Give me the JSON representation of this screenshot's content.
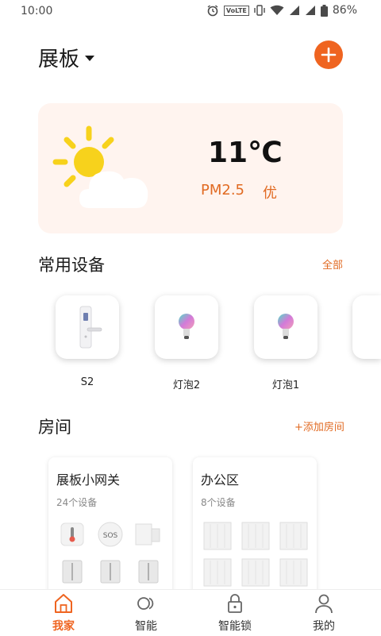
{
  "status_bar": {
    "time": "10:00",
    "network_badge": "VoLTE",
    "battery": "86%"
  },
  "header": {
    "home_name": "展板",
    "dropdown_icon": "caret-down-icon",
    "add_icon": "plus-icon"
  },
  "weather": {
    "temperature": "11℃",
    "pm_label": "PM2.5",
    "air_quality": "优",
    "icon": "partly-cloudy-icon"
  },
  "frequent_devices": {
    "title": "常用设备",
    "all_link": "全部",
    "items": [
      {
        "label": "S2",
        "icon": "smart-lock-icon"
      },
      {
        "label": "灯泡2",
        "icon": "bulb-icon"
      },
      {
        "label": "灯泡1",
        "icon": "bulb-icon"
      }
    ]
  },
  "rooms": {
    "title": "房间",
    "add_link": "+添加房间",
    "items": [
      {
        "name": "展板小网关",
        "device_count": "24个设备"
      },
      {
        "name": "办公区",
        "device_count": "8个设备"
      }
    ]
  },
  "tabbar": {
    "items": [
      {
        "label": "我家",
        "icon": "home-icon",
        "active": true
      },
      {
        "label": "智能",
        "icon": "smart-toggle-icon",
        "active": false
      },
      {
        "label": "智能锁",
        "icon": "padlock-icon",
        "active": false
      },
      {
        "label": "我的",
        "icon": "person-icon",
        "active": false
      }
    ]
  },
  "colors": {
    "accent": "#ef6420",
    "weather_bg": "#fff4ef",
    "sun": "#f7d21c"
  }
}
